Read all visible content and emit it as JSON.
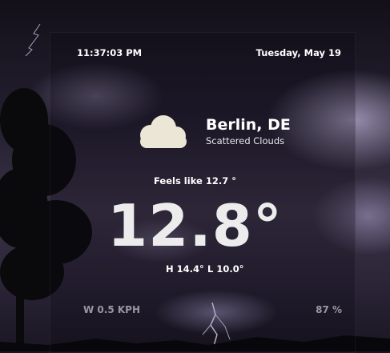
{
  "clock": {
    "time": "11:37:03 PM",
    "date": "Tuesday, May 19"
  },
  "location": {
    "city": "Berlin, DE",
    "condition": "Scattered Clouds",
    "icon": "cloud-icon"
  },
  "temperature": {
    "feels_like": "Feels like 12.7 °",
    "current": "12.8°",
    "high": "H 14.4°",
    "low": "L 10.0°"
  },
  "footer": {
    "wind": "W 0.5 KPH",
    "humidity": "87 %"
  },
  "colors": {
    "icon": "#ece6d6",
    "text": "#ffffff",
    "muted": "#8f8a99"
  }
}
